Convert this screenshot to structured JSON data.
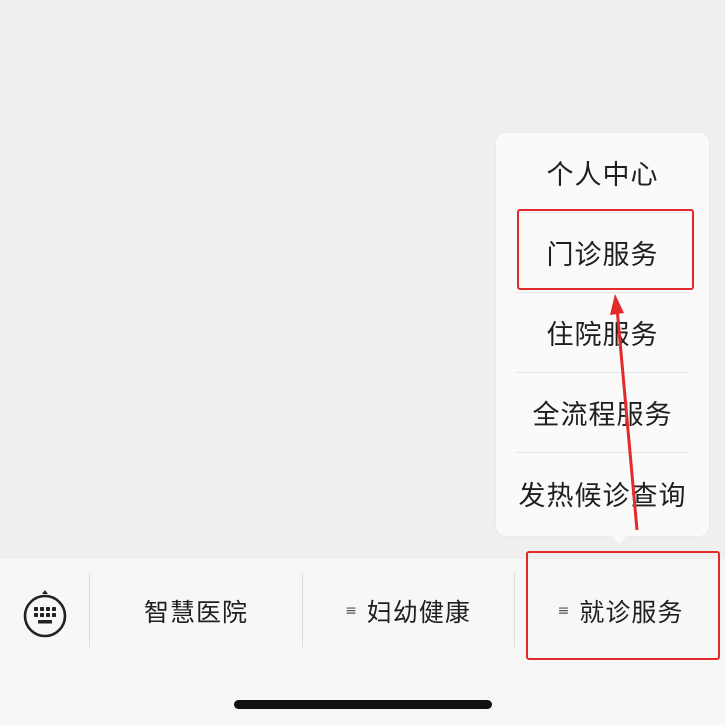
{
  "popup_menu": {
    "items": [
      {
        "label": "个人中心"
      },
      {
        "label": "门诊服务"
      },
      {
        "label": "住院服务"
      },
      {
        "label": "全流程服务"
      },
      {
        "label": "发热候诊查询"
      }
    ],
    "highlighted_item": "门诊服务"
  },
  "tabbar": {
    "keyboard_icon": "keyboard-icon",
    "tabs": [
      {
        "label": "智慧医院",
        "has_menu_icon": false
      },
      {
        "label": "妇幼健康",
        "has_menu_icon": true,
        "menu_icon": "≡"
      },
      {
        "label": "就诊服务",
        "has_menu_icon": true,
        "menu_icon": "≡"
      }
    ],
    "highlighted_tab": "就诊服务"
  },
  "annotation": {
    "color": "#e22a2a",
    "type": "arrow",
    "from": "就诊服务",
    "to": "门诊服务"
  }
}
